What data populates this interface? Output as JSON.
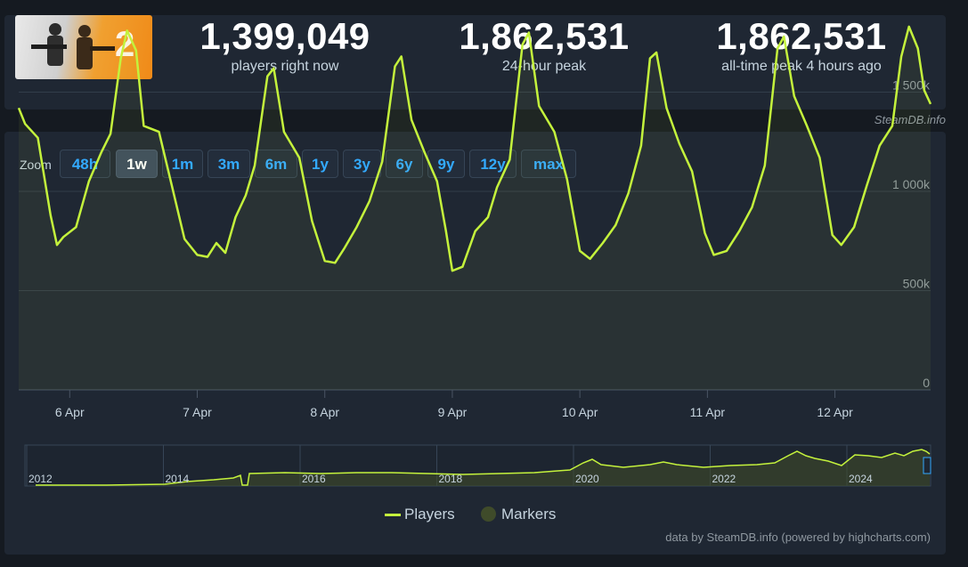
{
  "header": {
    "game_thumbnail_label": "COUNTER STRIKE 2",
    "stats": [
      {
        "value": "1,399,049",
        "label": "players right now"
      },
      {
        "value": "1,862,531",
        "label": "24-hour peak"
      },
      {
        "value": "1,862,531",
        "label": "all-time peak 4 hours ago"
      }
    ],
    "credit": "SteamDB.info"
  },
  "zoom": {
    "label": "Zoom",
    "buttons": [
      "48h",
      "1w",
      "1m",
      "3m",
      "6m",
      "1y",
      "3y",
      "6y",
      "9y",
      "12y",
      "max"
    ],
    "active": "1w"
  },
  "colors": {
    "series": "#c4f23c",
    "marker": "#3f4b2a",
    "accent": "#33aaff"
  },
  "chart_data": {
    "type": "line",
    "x_labels": [
      "6 Apr",
      "7 Apr",
      "8 Apr",
      "9 Apr",
      "10 Apr",
      "11 Apr",
      "12 Apr"
    ],
    "y_ticks": [
      "0",
      "500k",
      "1 000k",
      "1 500k"
    ],
    "ylim": [
      0,
      2000000
    ],
    "series": [
      {
        "name": "Players",
        "points": [
          [
            5.6,
            1420000
          ],
          [
            5.65,
            1340000
          ],
          [
            5.75,
            1270000
          ],
          [
            5.85,
            880000
          ],
          [
            5.9,
            730000
          ],
          [
            5.95,
            770000
          ],
          [
            6.05,
            820000
          ],
          [
            6.15,
            1050000
          ],
          [
            6.25,
            1200000
          ],
          [
            6.32,
            1290000
          ],
          [
            6.4,
            1670000
          ],
          [
            6.45,
            1810000
          ],
          [
            6.52,
            1710000
          ],
          [
            6.58,
            1330000
          ],
          [
            6.7,
            1300000
          ],
          [
            6.8,
            1030000
          ],
          [
            6.9,
            760000
          ],
          [
            7.0,
            680000
          ],
          [
            7.08,
            670000
          ],
          [
            7.15,
            740000
          ],
          [
            7.22,
            690000
          ],
          [
            7.3,
            870000
          ],
          [
            7.38,
            980000
          ],
          [
            7.45,
            1130000
          ],
          [
            7.55,
            1580000
          ],
          [
            7.6,
            1620000
          ],
          [
            7.68,
            1300000
          ],
          [
            7.8,
            1170000
          ],
          [
            7.9,
            850000
          ],
          [
            8.0,
            650000
          ],
          [
            8.08,
            640000
          ],
          [
            8.15,
            710000
          ],
          [
            8.25,
            820000
          ],
          [
            8.35,
            950000
          ],
          [
            8.45,
            1150000
          ],
          [
            8.55,
            1630000
          ],
          [
            8.6,
            1680000
          ],
          [
            8.68,
            1360000
          ],
          [
            8.78,
            1200000
          ],
          [
            8.88,
            1050000
          ],
          [
            8.95,
            800000
          ],
          [
            9.0,
            600000
          ],
          [
            9.08,
            620000
          ],
          [
            9.18,
            800000
          ],
          [
            9.28,
            870000
          ],
          [
            9.35,
            1020000
          ],
          [
            9.45,
            1160000
          ],
          [
            9.55,
            1740000
          ],
          [
            9.6,
            1800000
          ],
          [
            9.68,
            1430000
          ],
          [
            9.8,
            1300000
          ],
          [
            9.9,
            1060000
          ],
          [
            10.0,
            700000
          ],
          [
            10.08,
            660000
          ],
          [
            10.18,
            740000
          ],
          [
            10.28,
            830000
          ],
          [
            10.38,
            990000
          ],
          [
            10.48,
            1230000
          ],
          [
            10.55,
            1670000
          ],
          [
            10.6,
            1700000
          ],
          [
            10.68,
            1420000
          ],
          [
            10.78,
            1240000
          ],
          [
            10.88,
            1100000
          ],
          [
            10.98,
            790000
          ],
          [
            11.05,
            680000
          ],
          [
            11.15,
            700000
          ],
          [
            11.25,
            800000
          ],
          [
            11.35,
            920000
          ],
          [
            11.45,
            1130000
          ],
          [
            11.55,
            1720000
          ],
          [
            11.6,
            1780000
          ],
          [
            11.68,
            1480000
          ],
          [
            11.78,
            1330000
          ],
          [
            11.88,
            1170000
          ],
          [
            11.98,
            780000
          ],
          [
            12.05,
            730000
          ],
          [
            12.15,
            820000
          ],
          [
            12.25,
            1030000
          ],
          [
            12.35,
            1230000
          ],
          [
            12.45,
            1330000
          ],
          [
            12.52,
            1680000
          ],
          [
            12.58,
            1830000
          ],
          [
            12.65,
            1720000
          ],
          [
            12.7,
            1510000
          ],
          [
            12.75,
            1440000
          ]
        ]
      }
    ],
    "navigator": {
      "x_labels": [
        "2012",
        "2014",
        "2016",
        "2018",
        "2020",
        "2022",
        "2024"
      ]
    },
    "legend": [
      "Players",
      "Markers"
    ],
    "credit": "data by SteamDB.info (powered by highcharts.com)"
  }
}
